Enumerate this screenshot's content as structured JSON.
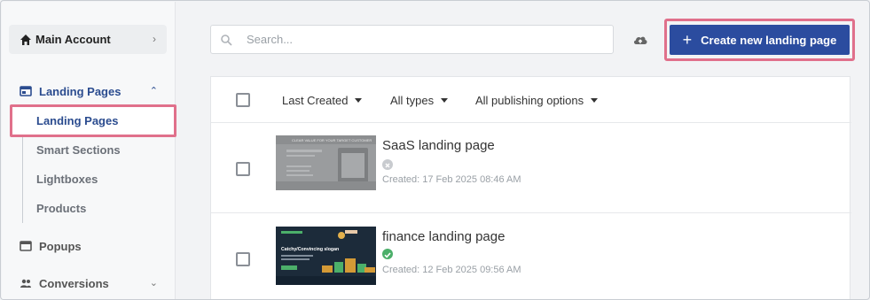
{
  "sidebar": {
    "account_label": "Main Account",
    "sections": [
      {
        "label": "Landing Pages",
        "icon": "landing-pages-icon",
        "expanded": true
      },
      {
        "label": "Popups",
        "icon": "popup-icon"
      },
      {
        "label": "Conversions",
        "icon": "people-icon"
      }
    ],
    "sub_items": [
      "Landing Pages",
      "Smart Sections",
      "Lightboxes",
      "Products"
    ]
  },
  "search": {
    "placeholder": "Search..."
  },
  "toolbar": {
    "cta_label": "Create new landing page",
    "filters": [
      "Last Created",
      "All types",
      "All publishing options"
    ]
  },
  "pages": [
    {
      "title": "SaaS landing page",
      "status": "unpublished",
      "created": "Created: 17 Feb 2025 08:46 AM",
      "thumb_text": "CLEAR VALUE FOR YOUR TARGET CUSTOMER"
    },
    {
      "title": "finance landing page",
      "status": "published",
      "created": "Created: 12 Feb 2025 09:56 AM",
      "thumb_text": "Catchy/Convincing slogan"
    }
  ],
  "colors": {
    "accent": "#2b4c9f",
    "highlight": "#e0708b",
    "published": "#4caf6a",
    "unpublished": "#c8cbcf"
  }
}
